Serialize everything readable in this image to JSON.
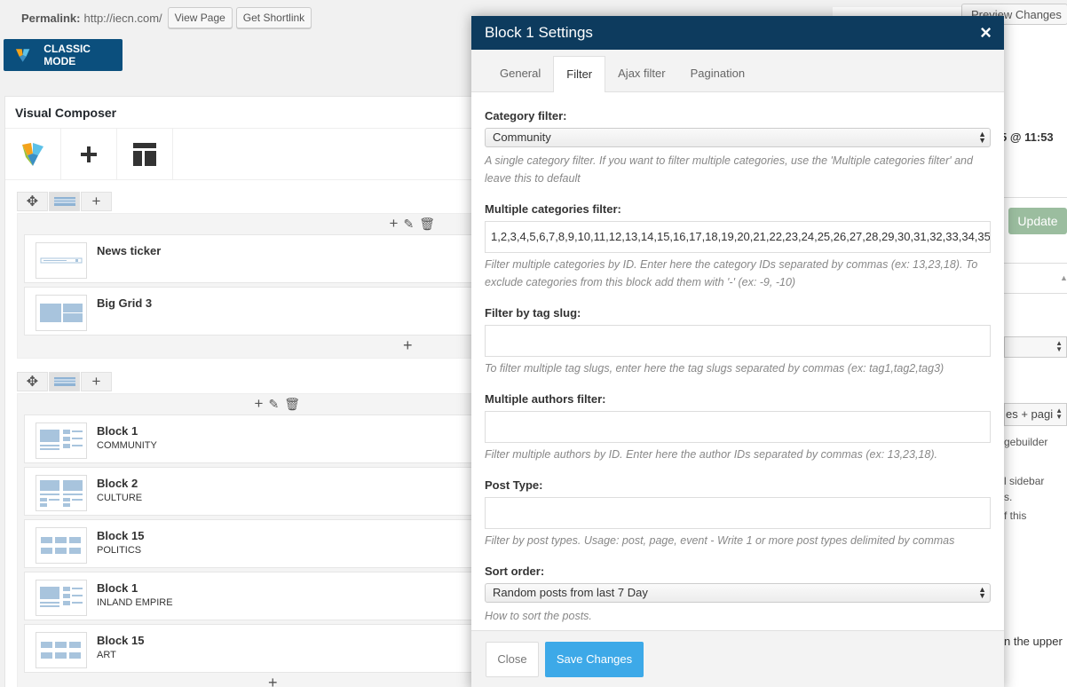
{
  "editor": {
    "permalink_label": "Permalink:",
    "permalink_url": "http://iecn.com/",
    "view_page": "View Page",
    "get_shortlink": "Get Shortlink",
    "classic_mode": "CLASSIC MODE",
    "vc_title": "Visual Composer"
  },
  "rows": [
    {
      "elements": [
        {
          "name": "News ticker",
          "sub": ""
        },
        {
          "name": "Big Grid 3",
          "sub": ""
        }
      ]
    },
    {
      "elements": [
        {
          "name": "Block 1",
          "sub": "COMMUNITY"
        },
        {
          "name": "Block 2",
          "sub": "CULTURE"
        },
        {
          "name": "Block 15",
          "sub": "POLITICS"
        },
        {
          "name": "Block 1",
          "sub": "INLAND EMPIRE"
        },
        {
          "name": "Block 15",
          "sub": "ART"
        }
      ]
    }
  ],
  "sidebar": {
    "preview_changes": "Preview Changes",
    "date": "5 @ 11:53",
    "update": "Update",
    "select_text": "es + pagi",
    "t1": "gebuilder",
    "t2": "l sidebar",
    "t3": "s.",
    "t4": "f this",
    "t5": "n the upper"
  },
  "modal": {
    "title": "Block 1 Settings",
    "close_symbol": "×",
    "tabs": [
      "General",
      "Filter",
      "Ajax filter",
      "Pagination"
    ],
    "active_tab": "Filter",
    "fields": {
      "category_filter": {
        "label": "Category filter:",
        "value": "Community",
        "help": "A single category filter. If you want to filter multiple categories, use the 'Multiple categories filter' and leave this to default"
      },
      "multiple_categories": {
        "label": "Multiple categories filter:",
        "value": "1,2,3,4,5,6,7,8,9,10,11,12,13,14,15,16,17,18,19,20,21,22,23,24,25,26,27,28,29,30,31,32,33,34,35",
        "help": "Filter multiple categories by ID. Enter here the category IDs separated by commas (ex: 13,23,18). To exclude categories from this block add them with '-' (ex: -9, -10)"
      },
      "tag_slug": {
        "label": "Filter by tag slug:",
        "value": "",
        "help": "To filter multiple tag slugs, enter here the tag slugs separated by commas (ex: tag1,tag2,tag3)"
      },
      "authors": {
        "label": "Multiple authors filter:",
        "value": "",
        "help": "Filter multiple authors by ID. Enter here the author IDs separated by commas (ex: 13,23,18)."
      },
      "post_type": {
        "label": "Post Type:",
        "value": "",
        "help": "Filter by post types. Usage: post, page, event - Write 1 or more post types delimited by commas"
      },
      "sort_order": {
        "label": "Sort order:",
        "value": "Random posts from last 7 Day",
        "help": "How to sort the posts."
      }
    },
    "close_button": "Close",
    "save_button": "Save Changes"
  }
}
